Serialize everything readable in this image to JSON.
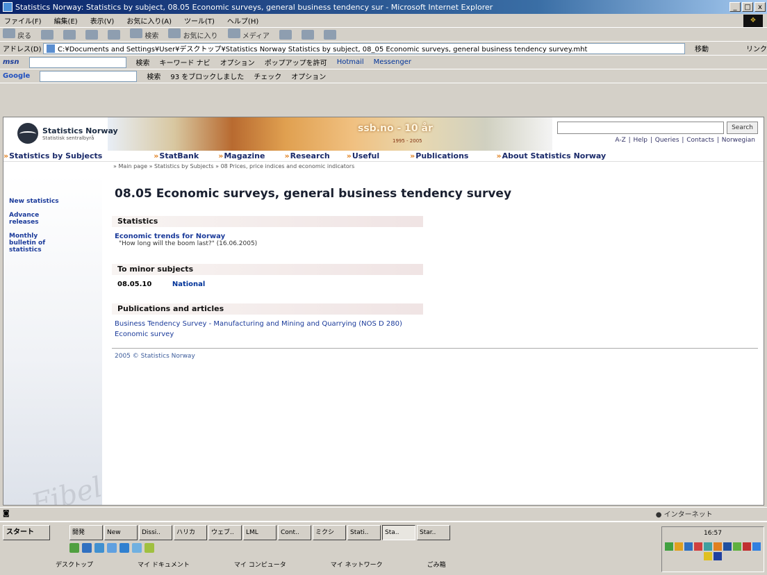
{
  "window": {
    "title": "Statistics Norway: Statistics by subject, 08.05 Economic surveys, general business tendency sur - Microsoft Internet Explorer",
    "min": "_",
    "max": "□",
    "close": "x"
  },
  "menubar": [
    "ファイル(F)",
    "編集(E)",
    "表示(V)",
    "お気に入り(A)",
    "ツール(T)",
    "ヘルプ(H)"
  ],
  "toolbar": [
    "戻る",
    "検索",
    "お気に入り",
    "メディア"
  ],
  "address": {
    "label": "アドレス(D)",
    "value": "C:¥Documents and Settings¥User¥デスクトップ¥Statistics Norway Statistics by subject, 08_05 Economic surveys, general business tendency survey.mht",
    "go": "移動",
    "links": "リンク"
  },
  "msnbar": {
    "logo": "msn",
    "search": "検索",
    "keyword": "キーワード ナビ",
    "options": "オプション",
    "popup": "ポップアップを許可",
    "hotmail": "Hotmail",
    "messenger": "Messenger"
  },
  "googlebar": {
    "logo": "Google",
    "search": "検索",
    "blocked": "93 をブロックしました",
    "check": "チェック",
    "options": "オプション"
  },
  "site": {
    "logo_name": "Statistics Norway",
    "logo_sub": "Statistisk sentralbyrå",
    "anniversary": "ssb.no - 10 år",
    "years": "1995 - 2005",
    "search_button": "Search",
    "toplinks": "A-Z | Help | Queries | Contacts | Norwegian",
    "nav": [
      "Statistics by Subjects",
      "StatBank",
      "Magazine",
      "Research",
      "Useful",
      "Publications",
      "About Statistics Norway"
    ],
    "breadcrumb": "» Main page » Statistics by Subjects » 08 Prices, price indices and economic indicators",
    "leftnav": [
      "New statistics",
      "Advance releases",
      "Monthly bulletin of statistics"
    ],
    "heading": "08.05 Economic surveys, general business tendency survey",
    "sections": {
      "statistics": {
        "title": "Statistics",
        "link": "Economic trends for Norway",
        "quote": "\"How long will the boom last?\" (16.06.2005)"
      },
      "minor": {
        "title": "To minor subjects",
        "code": "08.05.10",
        "link": "National"
      },
      "publications": {
        "title": "Publications and articles",
        "links": [
          "Business Tendency Survey - Manufacturing and Mining and Quarrying (NOS D 280)",
          "Economic survey"
        ]
      }
    },
    "footer": "2005 © Statistics Norway"
  },
  "statusbar": {
    "zone": "インターネット"
  },
  "taskbar": {
    "start": "スタート",
    "tasks": [
      "開発",
      "New",
      "Dissi..",
      "ハリカ",
      "ウェブ..",
      "LML",
      "Cont..",
      "ミクシ",
      "Stati..",
      "Sta..",
      "Star.."
    ],
    "desktop_items": [
      "デスクトップ",
      "マイ ドキュメント",
      "マイ コンピュータ",
      "マイ ネットワーク",
      "ごみ箱"
    ],
    "clock": "16:57"
  },
  "colors": {
    "title_bar": "#0a246a",
    "nav_text": "#1a2a6a",
    "link": "#1a3a9a",
    "bullet": "#e08020"
  }
}
